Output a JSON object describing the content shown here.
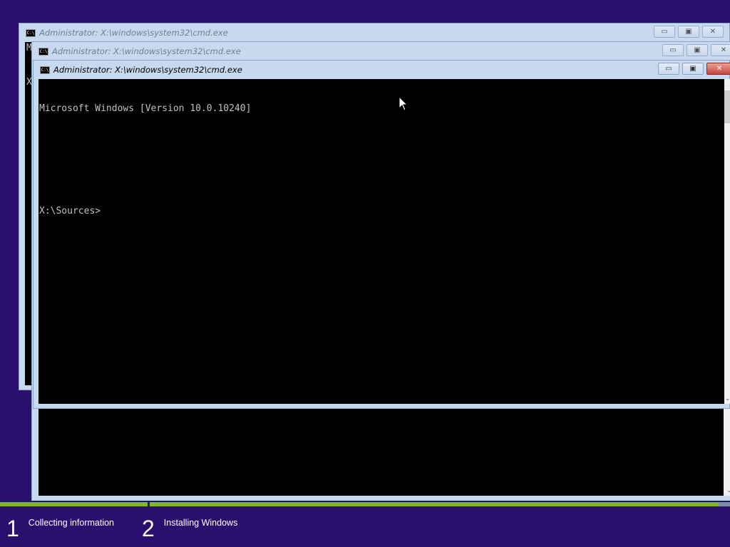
{
  "windows": [
    {
      "title": "Administrator: X:\\windows\\system32\\cmd.exe",
      "icon": "cmd-icon",
      "icon_glyph": "C:\\",
      "state": "inactive",
      "visible_text": [
        "M",
        "X"
      ],
      "controls": {
        "minimize": "▭",
        "maximize": "▣",
        "close": "✕"
      }
    },
    {
      "title": "Administrator: X:\\windows\\system32\\cmd.exe",
      "icon": "cmd-icon",
      "icon_glyph": "C:\\",
      "state": "inactive",
      "controls": {
        "minimize": "▭",
        "maximize": "▣",
        "close": "✕"
      }
    },
    {
      "title": "Administrator: X:\\windows\\system32\\cmd.exe",
      "icon": "cmd-icon",
      "icon_glyph": "C:\\",
      "state": "active",
      "console_lines": [
        "Microsoft Windows [Version 10.0.10240]",
        "",
        "",
        "X:\\Sources>"
      ],
      "controls": {
        "minimize": "▭",
        "maximize": "▣",
        "close": "✕"
      }
    }
  ],
  "setup_progress": {
    "steps": [
      {
        "number": "1",
        "label": "Collecting information",
        "progress": 1.0
      },
      {
        "number": "2",
        "label": "Installing Windows",
        "progress": 0.98
      }
    ]
  },
  "colors": {
    "desktop": "#2a0f6e",
    "progress_fill": "#7fb62e",
    "console_bg": "#000000",
    "console_text": "#c0c0c0"
  }
}
